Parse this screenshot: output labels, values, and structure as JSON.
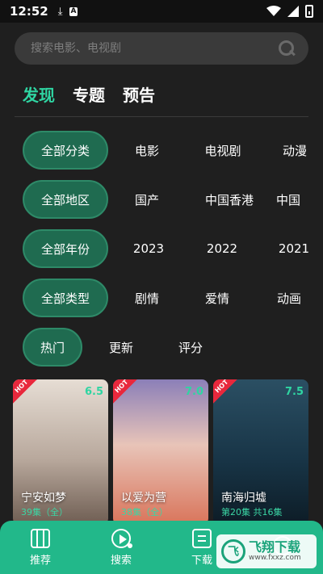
{
  "status_bar": {
    "time": "12:52",
    "left_icons": [
      "download-icon",
      "a-letter-icon"
    ],
    "right_icons": [
      "wifi-icon",
      "signal-icon",
      "battery-icon"
    ]
  },
  "search": {
    "placeholder": "搜索电影、电视剧"
  },
  "tabs": [
    {
      "label": "发现",
      "active": true
    },
    {
      "label": "专题",
      "active": false
    },
    {
      "label": "预告",
      "active": false
    }
  ],
  "filters": {
    "category": {
      "selected": "全部分类",
      "options": [
        "电影",
        "电视剧",
        "动漫"
      ]
    },
    "region": {
      "selected": "全部地区",
      "options": [
        "国产",
        "中国香港",
        "中国"
      ]
    },
    "year": {
      "selected": "全部年份",
      "options": [
        "2023",
        "2022",
        "2021"
      ]
    },
    "genre": {
      "selected": "全部类型",
      "options": [
        "剧情",
        "爱情",
        "动画"
      ]
    },
    "sort": {
      "selected": "热门",
      "options": [
        "更新",
        "评分"
      ]
    }
  },
  "cards": [
    {
      "title": "宁安如梦",
      "episodes": "39集（全）",
      "score": "6.5",
      "badge": "HOT",
      "colors": [
        "#e6ddd4",
        "#b8a89c",
        "#6e5d52"
      ]
    },
    {
      "title": "以爱为营",
      "episodes": "38集（全）",
      "score": "7.0",
      "badge": "HOT",
      "colors": [
        "#8b7fb8",
        "#e8c4b8",
        "#d9745a"
      ]
    },
    {
      "title": "南海归墟",
      "episodes": "第20集 共16集",
      "score": "7.5",
      "badge": "HOT",
      "colors": [
        "#2b4f63",
        "#183547",
        "#0d1c26"
      ]
    }
  ],
  "bottom_nav": [
    {
      "label": "推荐",
      "icon": "film-icon"
    },
    {
      "label": "搜索",
      "icon": "play-icon"
    },
    {
      "label": "下载",
      "icon": "download-icon"
    },
    {
      "label": "",
      "icon": "user-icon"
    }
  ],
  "watermark": {
    "logo": "飞",
    "line1": "飞翔下载",
    "line2": "www.fxxz.com"
  },
  "colors": {
    "accent": "#2fd5a2",
    "nav_bg": "#22b88a",
    "chip_bg": "#1f6b50",
    "page_bg": "#1f1f1f"
  }
}
